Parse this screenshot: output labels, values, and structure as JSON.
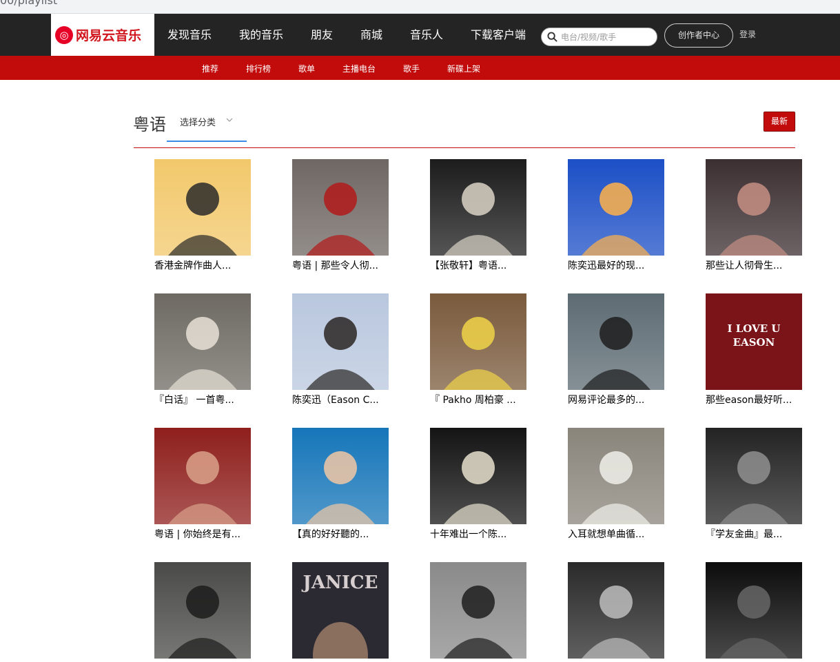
{
  "browser": {
    "url_fragment": "00/playlist"
  },
  "header": {
    "logo_badge": "◎",
    "logo_text": "网易云音乐",
    "nav": [
      "发现音乐",
      "我的音乐",
      "朋友",
      "商城",
      "音乐人",
      "下载客户端"
    ],
    "search_placeholder": "电台/视频/歌手",
    "creator_label": "创作者中心",
    "login_label": "登录"
  },
  "subnav": [
    "推荐",
    "排行榜",
    "歌单",
    "主播电台",
    "歌手",
    "新碟上架"
  ],
  "section": {
    "title": "粤语",
    "category_label": "选择分类",
    "sort_label": "最新"
  },
  "playlists": [
    {
      "title": "香港金牌作曲人...",
      "cover_bg": "#f2c86b",
      "cover_fg": "#2a2a2a"
    },
    {
      "title": "粤语 | 那些令人彻...",
      "cover_bg": "#6f6763",
      "cover_fg": "#b21a1a"
    },
    {
      "title": "【张敬轩】粤语...",
      "cover_bg": "#1c1c1c",
      "cover_fg": "#d9d2c6"
    },
    {
      "title": "陈奕迅最好的现...",
      "cover_bg": "#1c4fc6",
      "cover_fg": "#ffb24a"
    },
    {
      "title": "那些让人彻骨生...",
      "cover_bg": "#3c2f32",
      "cover_fg": "#c58e83"
    },
    {
      "title": "『白话』 一首粤...",
      "cover_bg": "#6e6a63",
      "cover_fg": "#e7e1d6"
    },
    {
      "title": "陈奕迅（Eason C...",
      "cover_bg": "#b9c7de",
      "cover_fg": "#2a2623"
    },
    {
      "title": "『 Pakho 周柏豪 ...",
      "cover_bg": "#7a5a3c",
      "cover_fg": "#f0d348"
    },
    {
      "title": "网易评论最多的...",
      "cover_bg": "#5d6b73",
      "cover_fg": "#1d1d1d"
    },
    {
      "title": "那些eason最好听...",
      "cover_bg": "#7a1418",
      "cover_fg": "#ffffff",
      "cover_text": [
        "I LOVE U",
        "EASON"
      ]
    },
    {
      "title": "粤语 | 你始终是有...",
      "cover_bg": "#8e1f1c",
      "cover_fg": "#d9a18a"
    },
    {
      "title": "【真的好好聽的...",
      "cover_bg": "#1676b9",
      "cover_fg": "#f1c7a4"
    },
    {
      "title": "十年难出一个陈...",
      "cover_bg": "#141414",
      "cover_fg": "#e6dfcd"
    },
    {
      "title": "入耳就想单曲循...",
      "cover_bg": "#8a857b",
      "cover_fg": "#efefe9"
    },
    {
      "title": "『学友金曲』最...",
      "cover_bg": "#232323",
      "cover_fg": "#8f8f8f"
    },
    {
      "title": "",
      "cover_bg": "#4a4a48",
      "cover_fg": "#1c1c1c"
    },
    {
      "title": "",
      "cover_bg": "#2b2a33",
      "cover_fg": "#d7cfcf",
      "cover_text": [
        "JANICE"
      ]
    },
    {
      "title": "",
      "cover_bg": "#8a8a8a",
      "cover_fg": "#1e1e1e"
    },
    {
      "title": "",
      "cover_bg": "#2a2a2a",
      "cover_fg": "#bdbdbd"
    },
    {
      "title": "",
      "cover_bg": "#0c0c0c",
      "cover_fg": "#666666"
    }
  ]
}
